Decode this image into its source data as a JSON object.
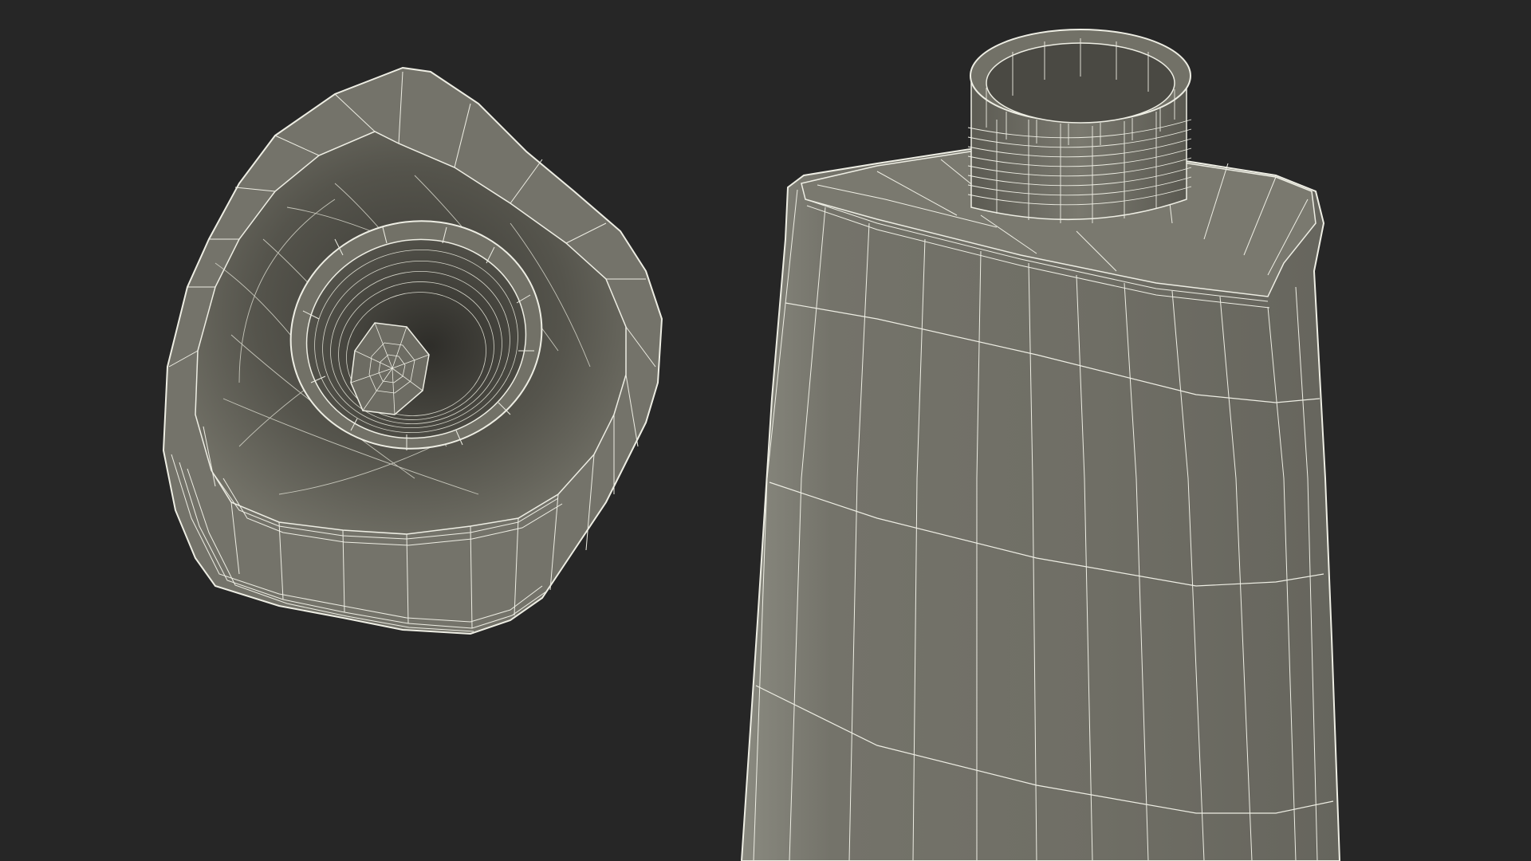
{
  "scene": {
    "background": "#262626",
    "mesh_fill": "#727167",
    "mesh_fill_dark": "#4f4e47",
    "mesh_fill_deep": "#3c3b36",
    "wire_color": "#eeeee4",
    "objects": [
      {
        "name": "tube-cap-mesh",
        "label": ""
      },
      {
        "name": "tube-body-mesh",
        "label": ""
      }
    ]
  }
}
